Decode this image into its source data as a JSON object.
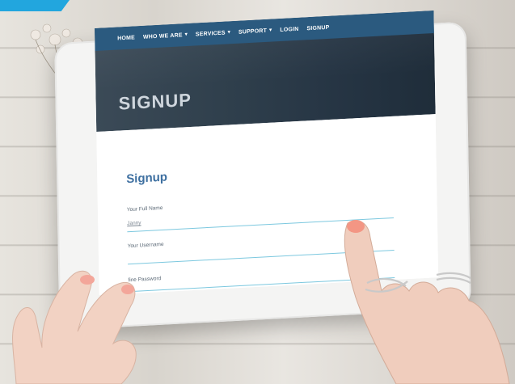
{
  "nav": {
    "items": [
      {
        "label": "HOME",
        "caret": ""
      },
      {
        "label": "WHO WE ARE",
        "caret": "▾"
      },
      {
        "label": "SERVICES",
        "caret": "▾"
      },
      {
        "label": "SUPPORT",
        "caret": "▾"
      },
      {
        "label": "LOGIN",
        "caret": ""
      },
      {
        "label": "SIGNUP",
        "caret": ""
      }
    ]
  },
  "hero": {
    "title": "SIGNUP"
  },
  "form": {
    "title": "Signup",
    "fields": [
      {
        "label": "Your Full Name",
        "value": "Janny"
      },
      {
        "label": "Your Username",
        "value": ""
      },
      {
        "label": "fine Password",
        "value": ""
      }
    ]
  },
  "colors": {
    "accent_tab": "#22a6de",
    "navbar": "#2b5a7f",
    "form_title": "#3d6fa0",
    "field_underline": "#7cc8df"
  }
}
